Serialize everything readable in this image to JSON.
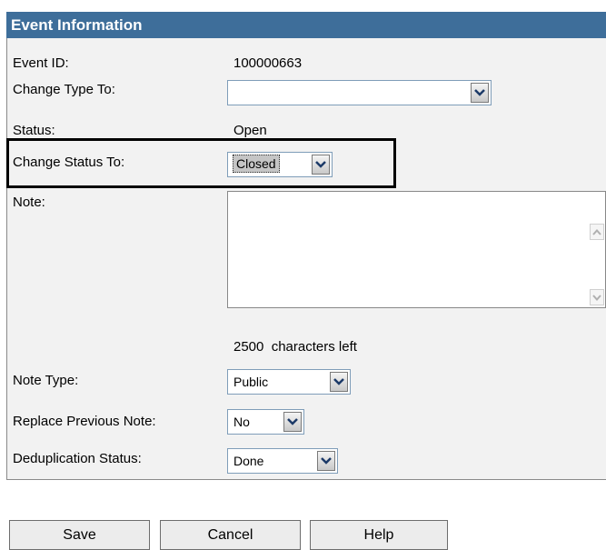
{
  "panel": {
    "title": "Event Information"
  },
  "fields": {
    "event_id": {
      "label": "Event ID:",
      "value": "100000663"
    },
    "change_type": {
      "label": "Change Type To:",
      "value": ""
    },
    "status": {
      "label": "Status:",
      "value": "Open"
    },
    "change_status": {
      "label": "Change Status To:",
      "value": "Closed"
    },
    "note": {
      "label": "Note:",
      "value": "",
      "chars_left": "2500  characters left"
    },
    "note_type": {
      "label": "Note Type:",
      "value": "Public"
    },
    "replace_previous_note": {
      "label": "Replace Previous Note:",
      "value": "No"
    },
    "deduplication_status": {
      "label": "Deduplication Status:",
      "value": "Done"
    }
  },
  "buttons": {
    "save": "Save",
    "cancel": "Cancel",
    "help": "Help"
  }
}
